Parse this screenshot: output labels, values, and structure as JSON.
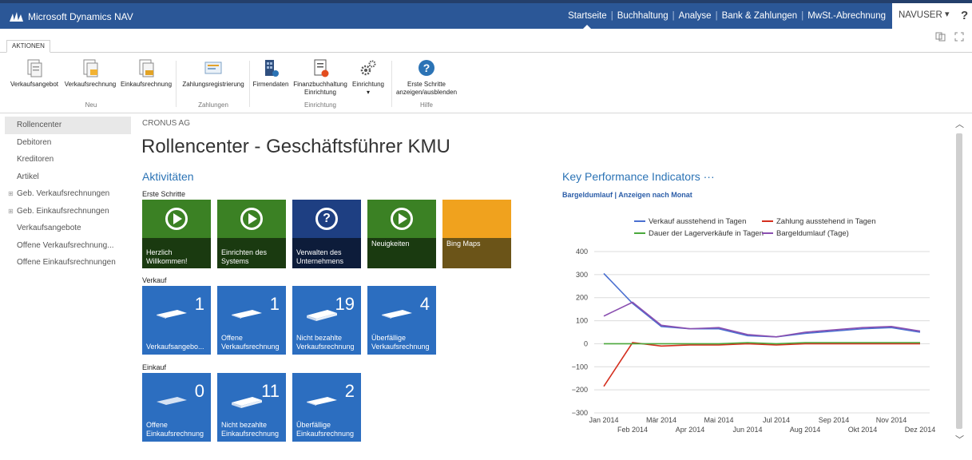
{
  "app": {
    "brand": "Microsoft Dynamics NAV"
  },
  "topnav": {
    "items": [
      "Startseite",
      "Buchhaltung",
      "Analyse",
      "Bank & Zahlungen",
      "MwSt.-Abrechnung"
    ],
    "user": "NAVUSER",
    "user_caret": "▾",
    "help": "?"
  },
  "ribbon": {
    "tab": "AKTIONEN",
    "buttons": [
      {
        "label": "Verkaufsangebot",
        "icon": "document-icon"
      },
      {
        "label": "Verkaufsrechnung",
        "icon": "invoice-icon"
      },
      {
        "label": "Einkaufsrechnung",
        "icon": "invoice-icon"
      },
      {
        "label": "Zahlungsregistrierung",
        "icon": "payment-icon"
      },
      {
        "label": "Firmendaten",
        "icon": "company-icon"
      },
      {
        "label": "Finanzbuchhaltung",
        "label2": "Einrichtung",
        "icon": "setup-icon"
      },
      {
        "label": "Einrichtung",
        "label2": "▾",
        "icon": "gears-icon"
      },
      {
        "label": "Erste Schritte",
        "label2": "anzeigen/ausblenden",
        "icon": "help-icon"
      }
    ],
    "groups": [
      "Neu",
      "Zahlungen",
      "Einrichtung",
      "Hilfe"
    ]
  },
  "leftnav": {
    "items": [
      {
        "label": "Rollencenter",
        "expand": ""
      },
      {
        "label": "Debitoren",
        "expand": ""
      },
      {
        "label": "Kreditoren",
        "expand": ""
      },
      {
        "label": "Artikel",
        "expand": ""
      },
      {
        "label": "Geb. Verkaufsrechnungen",
        "expand": "⊞"
      },
      {
        "label": "Geb. Einkaufsrechnungen",
        "expand": "⊞"
      },
      {
        "label": "Verkaufsangebote",
        "expand": ""
      },
      {
        "label": "Offene Verkaufsrechnung...",
        "expand": ""
      },
      {
        "label": "Offene Einkaufsrechnungen",
        "expand": ""
      }
    ]
  },
  "main": {
    "company": "CRONUS AG",
    "title": "Rollencenter - Geschäftsführer KMU",
    "activities_title": "Aktivitäten",
    "erste_schritte": "Erste Schritte",
    "verkauf": "Verkauf",
    "einkauf": "Einkauf",
    "start_tiles": [
      {
        "l1": "Herzlich",
        "l2": "Willkommen!",
        "icon": "play",
        "color": "green"
      },
      {
        "l1": "Einrichten des",
        "l2": "Systems",
        "icon": "play",
        "color": "green"
      },
      {
        "l1": "Verwalten des",
        "l2": "Unternehmens",
        "icon": "question",
        "color": "navy"
      },
      {
        "l1": "Neuigkeiten",
        "l2": "",
        "icon": "play",
        "color": "green"
      },
      {
        "l1": "Bing Maps",
        "l2": "",
        "icon": "none",
        "color": "orange"
      }
    ],
    "question_glyph": "?",
    "sales_tiles": [
      {
        "count": "1",
        "l1": "",
        "l2": "Verkaufsangebo..."
      },
      {
        "count": "1",
        "l1": "Offene",
        "l2": "Verkaufsrechnung"
      },
      {
        "count": "19",
        "l1": "Nicht bezahlte",
        "l2": "Verkaufsrechnung"
      },
      {
        "count": "4",
        "l1": "Überfällige",
        "l2": "Verkaufsrechnung"
      }
    ],
    "purchase_tiles": [
      {
        "count": "0",
        "l1": "Offene",
        "l2": "Einkaufsrechnung"
      },
      {
        "count": "11",
        "l1": "Nicht bezahlte",
        "l2": "Einkaufsrechnung"
      },
      {
        "count": "2",
        "l1": "Überfällige",
        "l2": "Einkaufsrechnung"
      }
    ]
  },
  "kpi": {
    "title": "Key Performance Indicators ···",
    "subtitle": "Bargeldumlauf | Anzeigen nach Monat"
  },
  "colors": {
    "nav_bar": "#2b5797",
    "tile_green": "#3b8124",
    "tile_navy": "#1e3f82",
    "tile_orange": "#f0a21e",
    "tile_blue": "#2c6ec0",
    "series_blue": "#4a6fd0",
    "series_red": "#d42f1f",
    "series_green": "#4aa83c",
    "series_purple": "#8a4fb0"
  },
  "chart_data": {
    "type": "line",
    "x": [
      "Jan 2014",
      "Feb 2014",
      "Mär 2014",
      "Apr 2014",
      "Mai 2014",
      "Jun 2014",
      "Jul 2014",
      "Aug 2014",
      "Sep 2014",
      "Okt 2014",
      "Nov 2014",
      "Dez 2014"
    ],
    "ylim": [
      -300,
      400
    ],
    "yticks": [
      400,
      300,
      200,
      100,
      0,
      -100,
      -200,
      -300
    ],
    "grid": true,
    "legend_position": "top",
    "series": [
      {
        "name": "Verkauf ausstehend in Tagen",
        "color": "#4a6fd0",
        "values": [
          305,
          175,
          75,
          65,
          65,
          35,
          30,
          45,
          55,
          65,
          70,
          50
        ]
      },
      {
        "name": "Zahlung ausstehend in Tagen",
        "color": "#d42f1f",
        "values": [
          -185,
          5,
          -10,
          -5,
          -5,
          0,
          -5,
          0,
          0,
          0,
          0,
          0
        ]
      },
      {
        "name": "Dauer der Lagerverkäufe in Tagen",
        "color": "#4aa83c",
        "values": [
          0,
          0,
          0,
          0,
          0,
          5,
          0,
          5,
          5,
          5,
          5,
          5
        ]
      },
      {
        "name": "Bargeldumlauf (Tage)",
        "color": "#8a4fb0",
        "values": [
          120,
          180,
          80,
          65,
          70,
          40,
          30,
          50,
          60,
          70,
          75,
          55
        ]
      }
    ]
  }
}
